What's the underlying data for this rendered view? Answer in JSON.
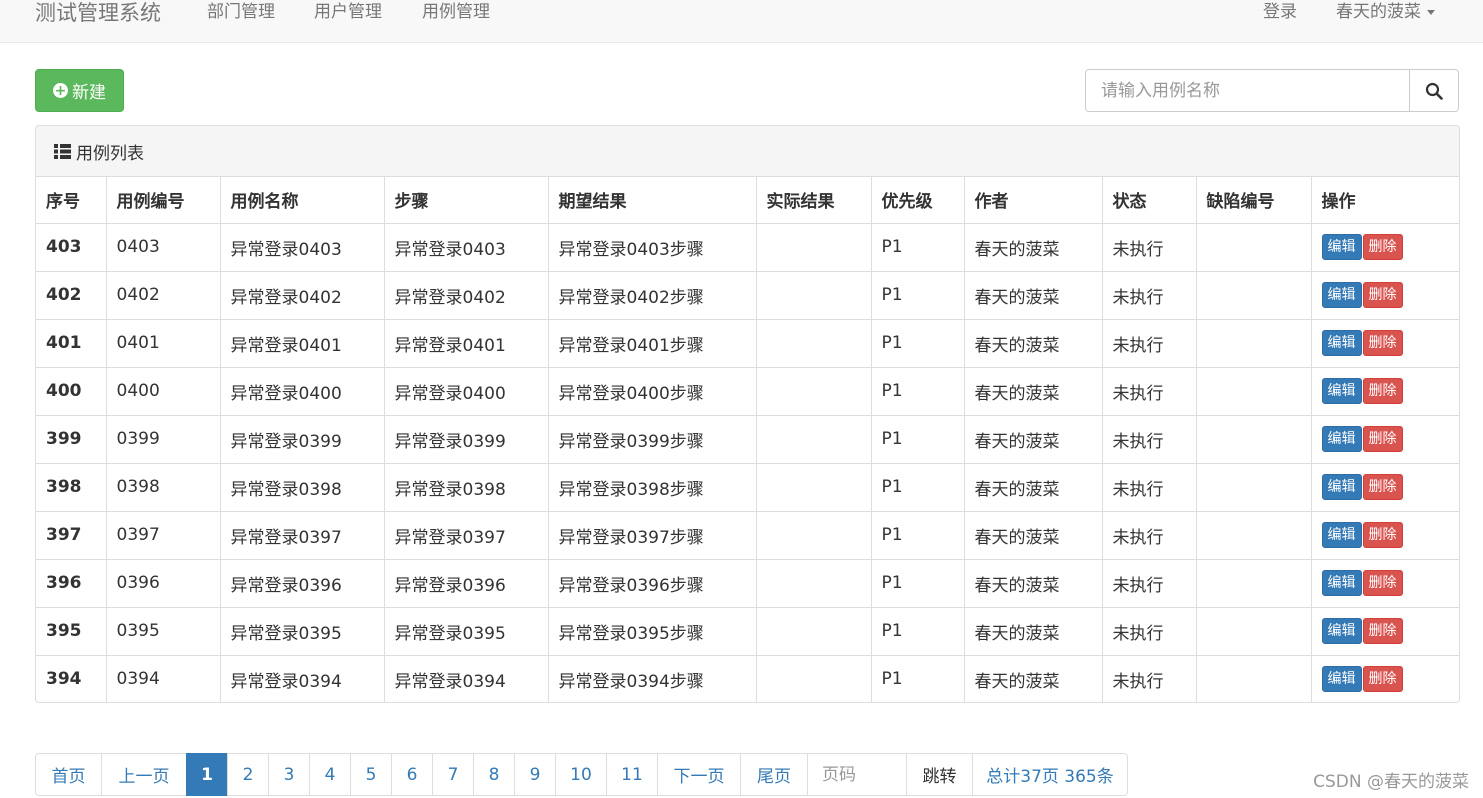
{
  "navbar": {
    "brand": "测试管理系统",
    "links": [
      "部门管理",
      "用户管理",
      "用例管理"
    ],
    "login": "登录",
    "user": "春天的菠菜"
  },
  "toolbar": {
    "new_label": "新建",
    "search_placeholder": "请输入用例名称"
  },
  "panel": {
    "title": "用例列表",
    "columns": [
      "序号",
      "用例编号",
      "用例名称",
      "步骤",
      "期望结果",
      "实际结果",
      "优先级",
      "作者",
      "状态",
      "缺陷编号",
      "操作"
    ],
    "edit_label": "编辑",
    "delete_label": "删除",
    "rows": [
      {
        "idx": "403",
        "code": "0403",
        "name": "异常登录0403",
        "step": "异常登录0403",
        "expect": "异常登录0403步骤",
        "actual": "",
        "priority": "P1",
        "author": "春天的菠菜",
        "status": "未执行",
        "bug": ""
      },
      {
        "idx": "402",
        "code": "0402",
        "name": "异常登录0402",
        "step": "异常登录0402",
        "expect": "异常登录0402步骤",
        "actual": "",
        "priority": "P1",
        "author": "春天的菠菜",
        "status": "未执行",
        "bug": ""
      },
      {
        "idx": "401",
        "code": "0401",
        "name": "异常登录0401",
        "step": "异常登录0401",
        "expect": "异常登录0401步骤",
        "actual": "",
        "priority": "P1",
        "author": "春天的菠菜",
        "status": "未执行",
        "bug": ""
      },
      {
        "idx": "400",
        "code": "0400",
        "name": "异常登录0400",
        "step": "异常登录0400",
        "expect": "异常登录0400步骤",
        "actual": "",
        "priority": "P1",
        "author": "春天的菠菜",
        "status": "未执行",
        "bug": ""
      },
      {
        "idx": "399",
        "code": "0399",
        "name": "异常登录0399",
        "step": "异常登录0399",
        "expect": "异常登录0399步骤",
        "actual": "",
        "priority": "P1",
        "author": "春天的菠菜",
        "status": "未执行",
        "bug": ""
      },
      {
        "idx": "398",
        "code": "0398",
        "name": "异常登录0398",
        "step": "异常登录0398",
        "expect": "异常登录0398步骤",
        "actual": "",
        "priority": "P1",
        "author": "春天的菠菜",
        "status": "未执行",
        "bug": ""
      },
      {
        "idx": "397",
        "code": "0397",
        "name": "异常登录0397",
        "step": "异常登录0397",
        "expect": "异常登录0397步骤",
        "actual": "",
        "priority": "P1",
        "author": "春天的菠菜",
        "status": "未执行",
        "bug": ""
      },
      {
        "idx": "396",
        "code": "0396",
        "name": "异常登录0396",
        "step": "异常登录0396",
        "expect": "异常登录0396步骤",
        "actual": "",
        "priority": "P1",
        "author": "春天的菠菜",
        "status": "未执行",
        "bug": ""
      },
      {
        "idx": "395",
        "code": "0395",
        "name": "异常登录0395",
        "step": "异常登录0395",
        "expect": "异常登录0395步骤",
        "actual": "",
        "priority": "P1",
        "author": "春天的菠菜",
        "status": "未执行",
        "bug": ""
      },
      {
        "idx": "394",
        "code": "0394",
        "name": "异常登录0394",
        "step": "异常登录0394",
        "expect": "异常登录0394步骤",
        "actual": "",
        "priority": "P1",
        "author": "春天的菠菜",
        "status": "未执行",
        "bug": ""
      }
    ]
  },
  "pagination": {
    "first": "首页",
    "prev": "上一页",
    "pages": [
      "1",
      "2",
      "3",
      "4",
      "5",
      "6",
      "7",
      "8",
      "9",
      "10",
      "11"
    ],
    "active_page": "1",
    "next": "下一页",
    "last": "尾页",
    "page_placeholder": "页码",
    "jump": "跳转",
    "total": "总计37页 365条"
  },
  "watermark": "CSDN @春天的菠菜",
  "colors": {
    "success": "#5cb85c",
    "primary": "#337ab7",
    "danger": "#d9534f"
  }
}
